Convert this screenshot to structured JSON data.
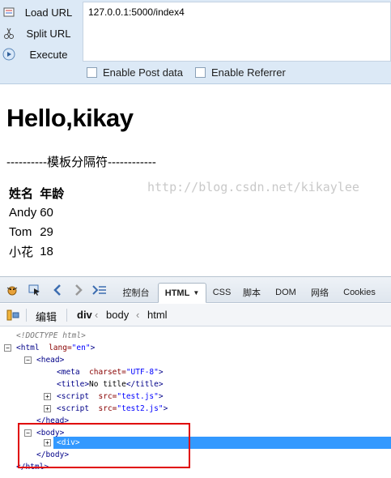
{
  "hackbar": {
    "load_url": "Load URL",
    "split_url": "Split URL",
    "execute": "Execute",
    "url_value": "127.0.0.1:5000/index4",
    "enable_post": "Enable Post data",
    "enable_referrer": "Enable Referrer"
  },
  "page": {
    "heading": "Hello,kikay",
    "divider": "----------模板分隔符------------",
    "table": {
      "headers": [
        "姓名",
        "年龄"
      ],
      "rows": [
        [
          "Andy",
          "60"
        ],
        [
          "Tom",
          "29"
        ],
        [
          "小花",
          "18"
        ]
      ]
    }
  },
  "firebug": {
    "tabs": [
      "控制台",
      "HTML",
      "CSS",
      "脚本",
      "DOM",
      "网络",
      "Cookies"
    ],
    "active_tab": "HTML",
    "edit_label": "编辑",
    "breadcrumb": [
      "div",
      "body",
      "html"
    ],
    "tree": {
      "doctype": "<!DOCTYPE html>",
      "html_open": "<html",
      "lang_attr": "lang=",
      "lang_val": "\"en\"",
      "head_open": "<head>",
      "meta": "<meta",
      "charset_attr": "charset=",
      "charset_val": "\"UTF-8\"",
      "title_open": "<title>",
      "title_text": "No title",
      "title_close": "</title>",
      "script1_open": "<script",
      "script1_attr": "src=",
      "script1_val": "\"test.js\"",
      "script2_open": "<script",
      "script2_attr": "src=",
      "script2_val": "\"test2.js\"",
      "head_close": "</head>",
      "body_open": "<body>",
      "div": "<div>",
      "body_close": "</body>",
      "html_close": "</html>"
    }
  },
  "watermark": "http://blog.csdn.net/kikaylee"
}
